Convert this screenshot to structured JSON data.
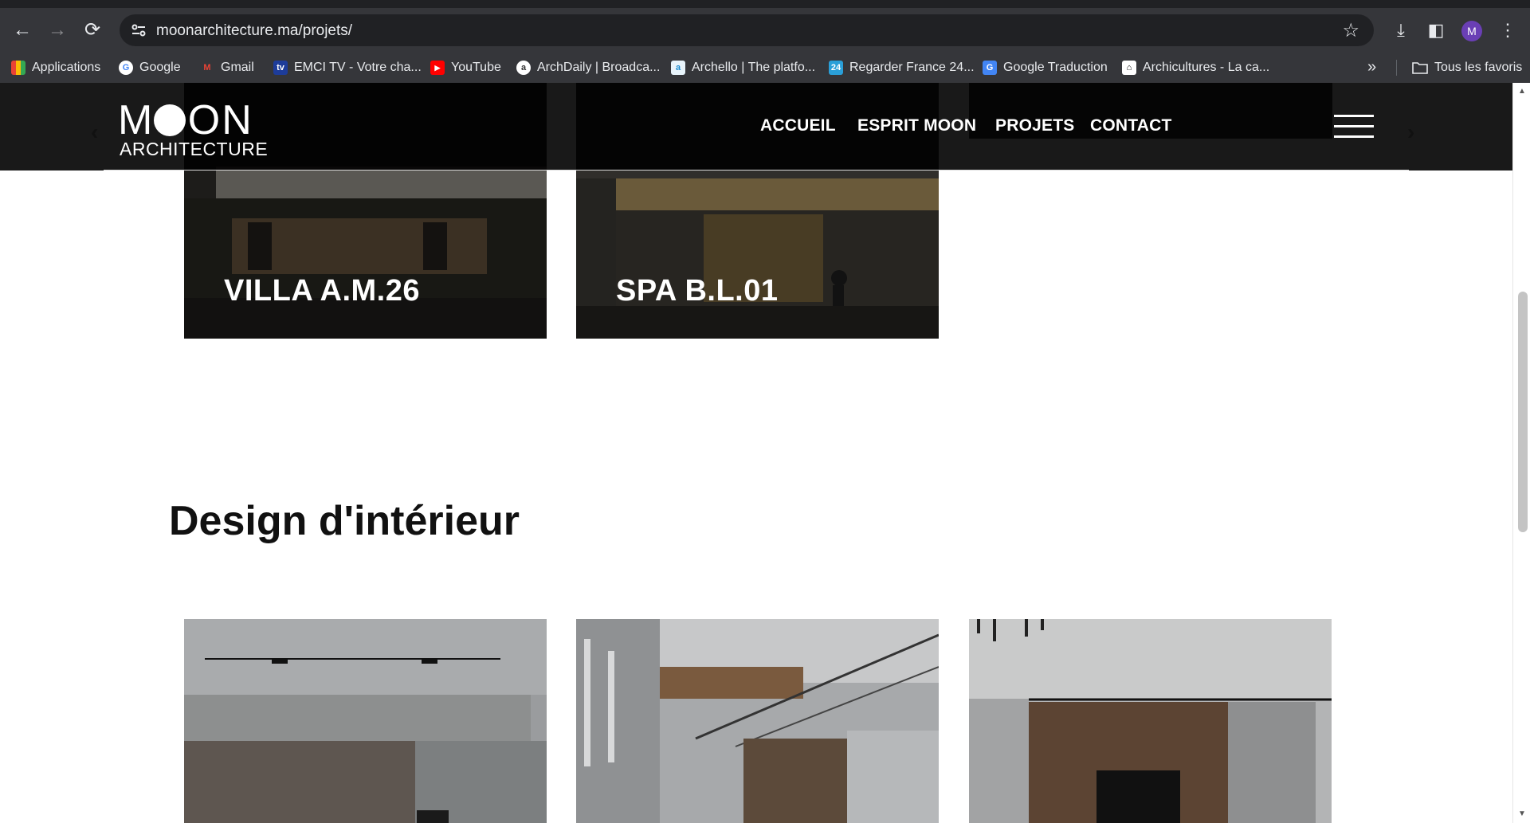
{
  "browser": {
    "url": "moonarchitecture.ma/projets/",
    "avatar_letter": "M",
    "bookmarks": [
      {
        "label": "Applications",
        "icon": "apps-grid-icon"
      },
      {
        "label": "Google",
        "icon": "google-icon"
      },
      {
        "label": "Gmail",
        "icon": "gmail-icon"
      },
      {
        "label": "EMCI TV - Votre cha...",
        "icon": "emci-tv-icon"
      },
      {
        "label": "YouTube",
        "icon": "youtube-icon"
      },
      {
        "label": "ArchDaily | Broadca...",
        "icon": "archdaily-icon"
      },
      {
        "label": "Archello | The platfo...",
        "icon": "archello-icon"
      },
      {
        "label": "Regarder France 24...",
        "icon": "france24-icon"
      },
      {
        "label": "Google Traduction",
        "icon": "google-translate-icon"
      },
      {
        "label": "Archicultures - La ca...",
        "icon": "archicultures-icon"
      }
    ],
    "overflow_label": "»",
    "all_bookmarks_label": "Tous les favoris"
  },
  "site": {
    "logo_top": "MOON",
    "logo_bottom": "ARCHITECTURE",
    "nav": [
      {
        "label": "ACCUEIL"
      },
      {
        "label": "ESPRIT MOON"
      },
      {
        "label": "PROJETS"
      },
      {
        "label": "CONTACT"
      }
    ]
  },
  "projects_top": [
    {
      "title": "VILLA A.M.26"
    },
    {
      "title": "SPA B.L.01"
    }
  ],
  "section": {
    "title": "Design d'intérieur"
  },
  "colors": {
    "header_bg": "#000000",
    "chrome_bg": "#35363a",
    "accent_avatar": "#6a3fb5"
  }
}
